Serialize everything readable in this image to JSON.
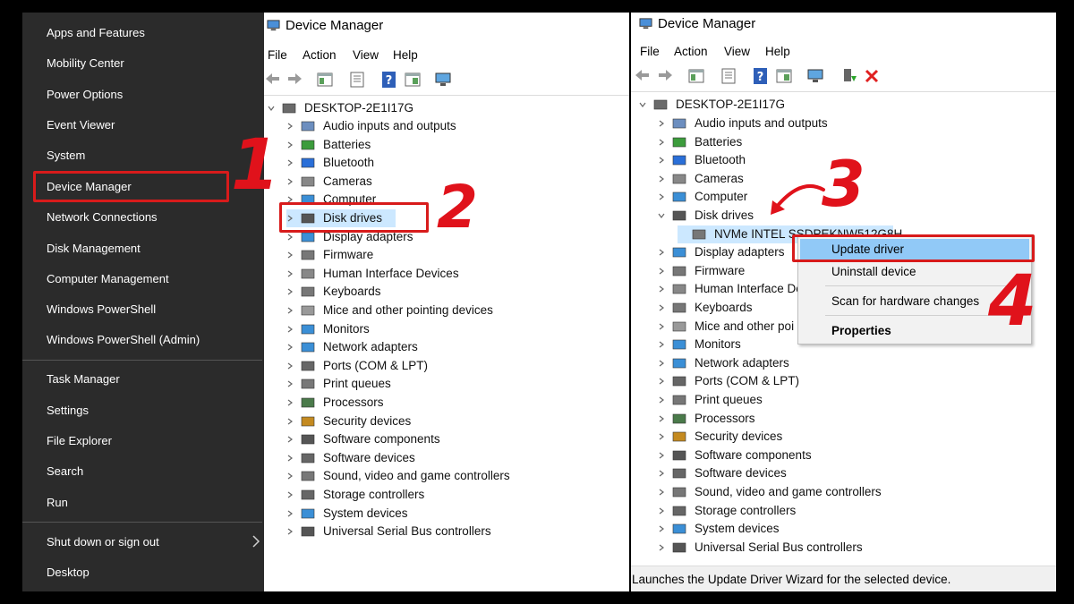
{
  "winx_menu": {
    "group1": [
      "Apps and Features",
      "Mobility Center",
      "Power Options",
      "Event Viewer",
      "System",
      "Device Manager",
      "Network Connections",
      "Disk Management",
      "Computer Management",
      "Windows PowerShell",
      "Windows PowerShell (Admin)"
    ],
    "group2": [
      "Task Manager",
      "Settings",
      "File Explorer",
      "Search",
      "Run"
    ],
    "group3": [
      "Shut down or sign out",
      "Desktop"
    ]
  },
  "window_left": {
    "title": "Device Manager",
    "menu": [
      "File",
      "Action",
      "View",
      "Help"
    ],
    "computer": "DESKTOP-2E1I17G",
    "categories": [
      "Audio inputs and outputs",
      "Batteries",
      "Bluetooth",
      "Cameras",
      "Computer",
      "Disk drives",
      "Display adapters",
      "Firmware",
      "Human Interface Devices",
      "Keyboards",
      "Mice and other pointing devices",
      "Monitors",
      "Network adapters",
      "Ports (COM & LPT)",
      "Print queues",
      "Processors",
      "Security devices",
      "Software components",
      "Software devices",
      "Sound, video and game controllers",
      "Storage controllers",
      "System devices",
      "Universal Serial Bus controllers"
    ]
  },
  "window_right": {
    "title": "Device Manager",
    "menu": [
      "File",
      "Action",
      "View",
      "Help"
    ],
    "computer": "DESKTOP-2E1I17G",
    "categories": [
      "Audio inputs and outputs",
      "Batteries",
      "Bluetooth",
      "Cameras",
      "Computer",
      "Disk drives",
      "NVMe INTEL SSDPEKNW512G8H",
      "Display adapters",
      "Firmware",
      "Human Interface De",
      "Keyboards",
      "Mice and other poi",
      "Monitors",
      "Network adapters",
      "Ports (COM & LPT)",
      "Print queues",
      "Processors",
      "Security devices",
      "Software components",
      "Software devices",
      "Sound, video and game controllers",
      "Storage controllers",
      "System devices",
      "Universal Serial Bus controllers"
    ],
    "status": "Launches the Update Driver Wizard for the selected device."
  },
  "context_menu": {
    "update": "Update driver",
    "uninstall": "Uninstall device",
    "scan": "Scan for hardware changes",
    "properties": "Properties"
  },
  "steps": [
    "1",
    "2",
    "3",
    "4"
  ],
  "colors": {
    "highlight": "#d81b1b",
    "selection": "#cce8ff",
    "menu_bg": "#2b2b2b"
  }
}
